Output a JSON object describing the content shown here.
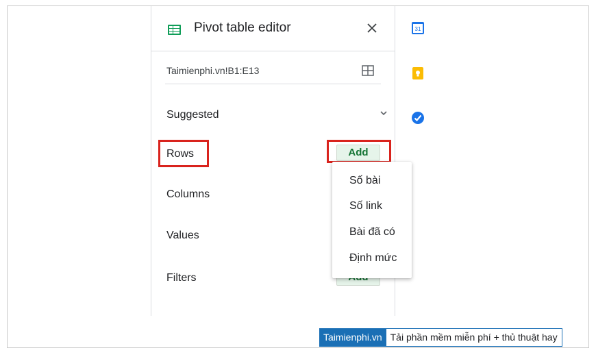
{
  "panel": {
    "title": "Pivot table editor",
    "range": "Taimienphi.vn!B1:E13"
  },
  "sections": {
    "suggested": "Suggested",
    "rows": "Rows",
    "columns": "Columns",
    "values": "Values",
    "filters": "Filters"
  },
  "buttons": {
    "rows_add": "Add",
    "filters_add": "Add"
  },
  "dropdown": {
    "items": [
      "Số bài",
      "Số link",
      "Bài đã có",
      "Định mức"
    ]
  },
  "side_icons": [
    "calendar-icon",
    "keep-icon",
    "tasks-icon"
  ],
  "calendar_day": "31",
  "colors": {
    "sheets_green": "#0f9d58",
    "add_bg": "#e6f4ea",
    "add_text": "#137333",
    "highlight_red": "#d9231d",
    "brand_blue": "#1a6fb5"
  },
  "footer": {
    "brand": "Taimienphi.vn",
    "slogan": "Tải phần mềm miễn phí + thủ thuật hay"
  }
}
